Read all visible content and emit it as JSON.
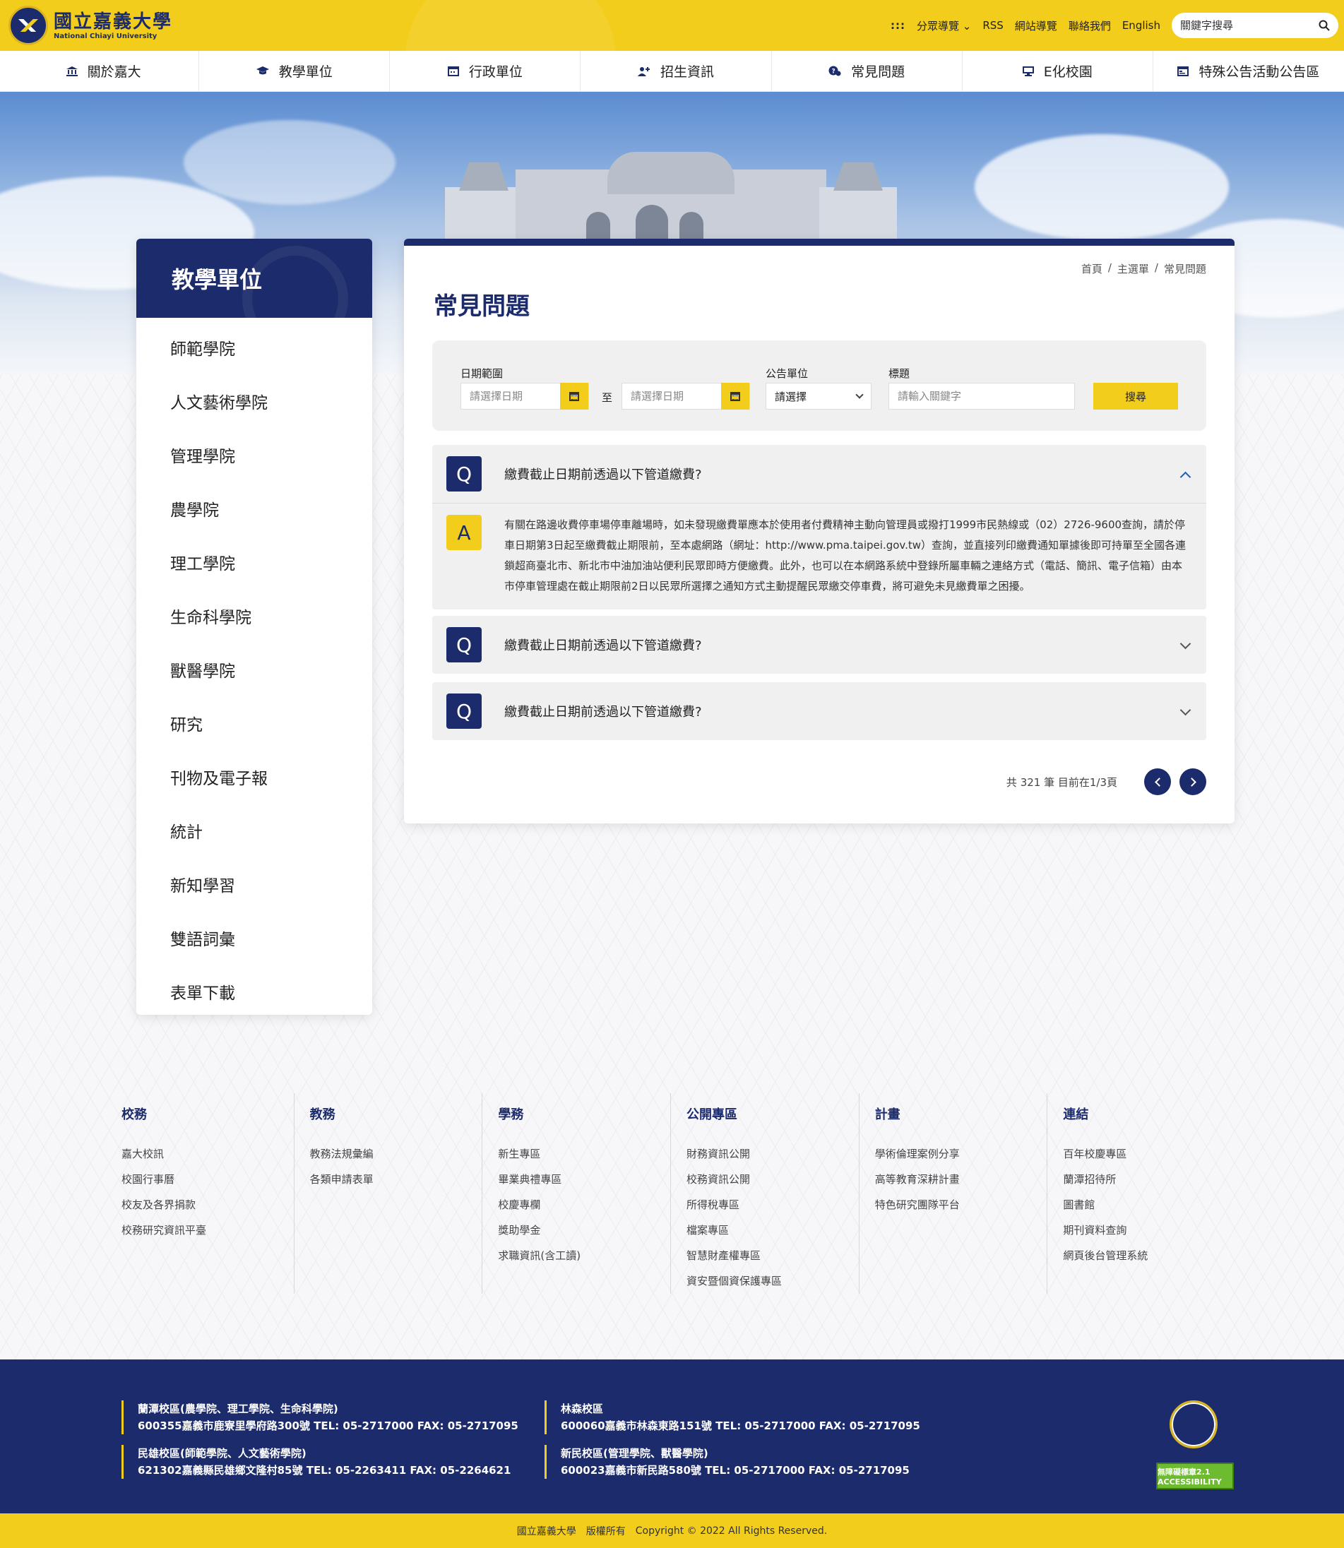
{
  "header": {
    "logo_zh": "國立嘉義大學",
    "logo_en": "National Chiayi University",
    "links": {
      "sitemap_grid": ":::",
      "category_nav": "分眾導覽",
      "rss": "RSS",
      "site_nav": "網站導覽",
      "contact": "聯絡我們",
      "english": "English"
    },
    "search_placeholder": "關鍵字搜尋"
  },
  "nav": {
    "items": [
      {
        "label": "關於嘉大",
        "icon": "bank-icon"
      },
      {
        "label": "教學單位",
        "icon": "graduation-cap-icon"
      },
      {
        "label": "行政單位",
        "icon": "calendar-icon"
      },
      {
        "label": "招生資訊",
        "icon": "user-add-icon"
      },
      {
        "label": "常見問題",
        "icon": "question-chat-icon"
      },
      {
        "label": "E化校園",
        "icon": "monitor-icon"
      },
      {
        "label": "特殊公告活動公告區",
        "icon": "calendar-list-icon"
      }
    ]
  },
  "sidebar": {
    "title": "教學單位",
    "items": [
      "師範學院",
      "人文藝術學院",
      "管理學院",
      "農學院",
      "理工學院",
      "生命科學院",
      "獸醫學院",
      "研究",
      "刊物及電子報",
      "統計",
      "新知學習",
      "雙語詞彙",
      "表單下載"
    ]
  },
  "breadcrumb": {
    "home": "首頁",
    "sep": "/",
    "menu": "主選單",
    "current": "常見問題"
  },
  "page_title": "常見問題",
  "filter": {
    "date_label": "日期範圍",
    "date_placeholder": "請選擇日期",
    "to": "至",
    "unit_label": "公告單位",
    "unit_value": "請選擇",
    "title_label": "標題",
    "title_placeholder": "請輸入關鍵字",
    "search_label": "搜尋"
  },
  "faq": {
    "q_badge": "Q",
    "a_badge": "A",
    "items": [
      {
        "question": "繳費截止日期前透過以下管道繳費?",
        "answer": "有關在路邊收費停車場停車離場時，如未發現繳費單應本於使用者付費精神主動向管理員或撥打1999市民熱線或（02）2726-9600查詢，請於停車日期第3日起至繳費截止期限前，至本處網路（網址：http://www.pma.taipei.gov.tw）查詢，並直接列印繳費通知單據後即可持單至全國各連鎖超商臺北市、新北市中油加油站便利民眾即時方便繳費。此外，也可以在本網路系統中登錄所屬車輛之連絡方式（電話、簡訊、電子信箱）由本市停車管理處在截止期限前2日以民眾所選擇之通知方式主動提醒民眾繳交停車費，將可避免未見繳費單之困擾。"
      },
      {
        "question": "繳費截止日期前透過以下管道繳費?"
      },
      {
        "question": "繳費截止日期前透過以下管道繳費?"
      }
    ]
  },
  "pagination": {
    "summary": "共 321 筆  目前在1/3頁"
  },
  "footer_links": [
    {
      "title": "校務",
      "links": [
        "嘉大校訊",
        "校園行事曆",
        "校友及各界捐款",
        "校務研究資訊平臺"
      ]
    },
    {
      "title": "教務",
      "links": [
        "教務法規彙編",
        "各類申請表單"
      ]
    },
    {
      "title": "學務",
      "links": [
        "新生專區",
        "畢業典禮專區",
        "校慶專欄",
        "獎助學金",
        "求職資訊(含工讀)"
      ]
    },
    {
      "title": "公開專區",
      "links": [
        "財務資訊公開",
        "校務資訊公開",
        "所得稅專區",
        "檔案專區",
        "智慧財產權專區",
        "資安暨個資保護專區"
      ]
    },
    {
      "title": "計畫",
      "links": [
        "學術倫理案例分享",
        "高等教育深耕計畫",
        "特色研究團隊平台"
      ]
    },
    {
      "title": "連結",
      "links": [
        "百年校慶專區",
        "蘭潭招待所",
        "圖書館",
        "期刊資料查詢",
        "網頁後台管理系統"
      ]
    }
  ],
  "campuses": [
    {
      "name": "蘭潭校區(農學院、理工學院、生命科學院)",
      "address": "600355嘉義市鹿寮里學府路300號 TEL: 05-2717000 FAX: 05-2717095"
    },
    {
      "name": "民雄校區(師範學院、人文藝術學院)",
      "address": "621302嘉義縣民雄鄉文隆村85號 TEL: 05-2263411 FAX: 05-2264621"
    },
    {
      "name": "林森校區",
      "address": "600060嘉義市林森東路151號 TEL: 05-2717000 FAX: 05-2717095"
    },
    {
      "name": "新民校區(管理學院、獸醫學院)",
      "address": "600023嘉義市新民路580號 TEL: 05-2717000 FAX: 05-2717095"
    }
  ],
  "accessibility_badge": "無障礙標章2.1 ACCESSIBILITY",
  "copyright": {
    "school": "國立嘉義大學",
    "rights": "版權所有",
    "text": "Copyright © 2022 All Rights Reserved."
  },
  "colors": {
    "brand_yellow": "#f2cd1b",
    "brand_navy": "#1c2b6b"
  }
}
